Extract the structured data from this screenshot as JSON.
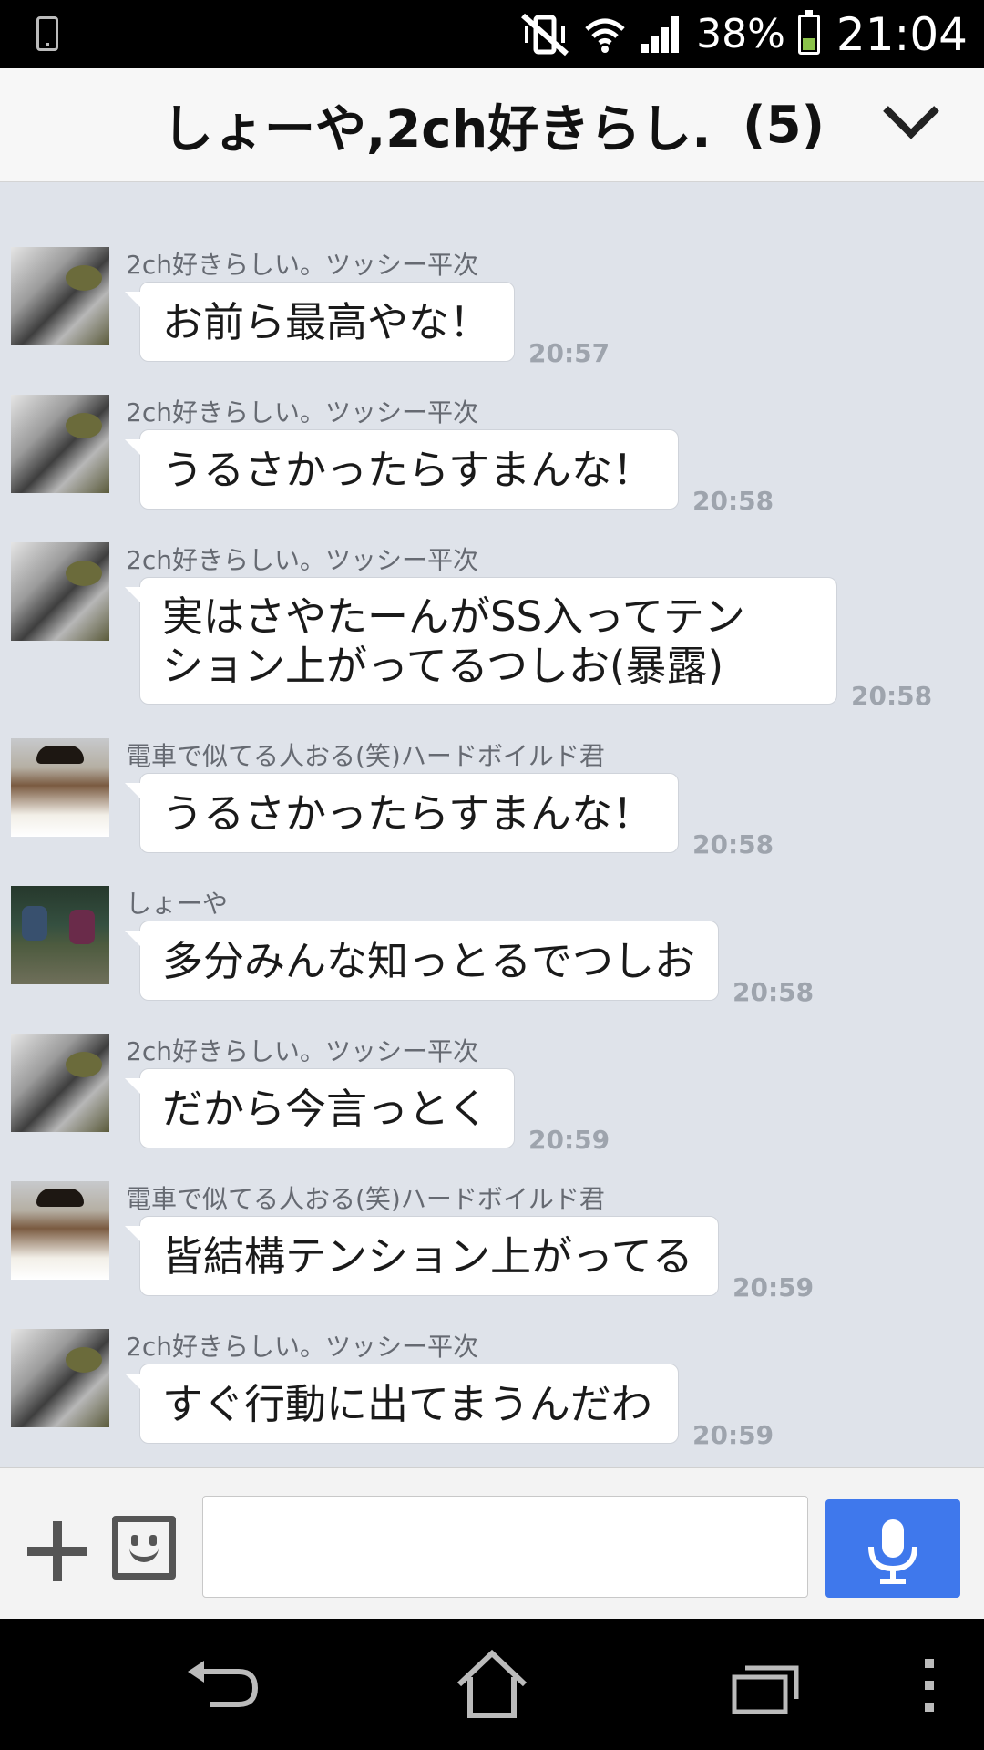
{
  "status_bar": {
    "battery_percent": "38%",
    "time": "21:04",
    "battery_level": 0.38,
    "battery_color": "#8bc34a",
    "icons": [
      "phone-icon",
      "vibrate-icon",
      "wifi-icon",
      "signal-icon",
      "battery-icon"
    ]
  },
  "header": {
    "title": "しょーや,2ch好きらし...",
    "member_count": "(5)",
    "toggle_icon": "chevron-down-icon"
  },
  "messages": [
    {
      "sender": "",
      "text": "お前ら最高やな！",
      "time": "20:57",
      "avatar": "dog"
    },
    {
      "sender": "2ch好きらしい。ツッシー平次",
      "text": "お前ら最高やな！",
      "time": "20:57",
      "avatar": "dog"
    },
    {
      "sender": "2ch好きらしい。ツッシー平次",
      "text": "うるさかったらすまんな！",
      "time": "20:58",
      "avatar": "dog"
    },
    {
      "sender": "2ch好きらしい。ツッシー平次",
      "text": "実はさやたーんがSS入ってテン\nション上がってるつしお(暴露)",
      "time": "20:58",
      "avatar": "dog"
    },
    {
      "sender": "電車で似てる人おる(笑)ハードボイルド君",
      "text": "うるさかったらすまんな！",
      "time": "20:58",
      "avatar": "boy"
    },
    {
      "sender": "しょーや",
      "text": "多分みんな知っとるでつしお",
      "time": "20:58",
      "avatar": "group"
    },
    {
      "sender": "2ch好きらしい。ツッシー平次",
      "text": "だから今言っとく",
      "time": "20:59",
      "avatar": "dog"
    },
    {
      "sender": "電車で似てる人おる(笑)ハードボイルド君",
      "text": "皆結構テンション上がってる",
      "time": "20:59",
      "avatar": "boy"
    },
    {
      "sender": "2ch好きらしい。ツッシー平次",
      "text": "すぐ行動に出てまうんだわ",
      "time": "20:59",
      "avatar": "dog"
    }
  ],
  "input_bar": {
    "message_value": "",
    "add_icon": "plus-icon",
    "sticker_icon": "emoji-icon",
    "voice_icon": "microphone-icon",
    "accent_color": "#3f78ec"
  },
  "nav_bar": {
    "icons": [
      "back-icon",
      "home-icon",
      "recent-apps-icon",
      "overflow-menu-icon"
    ]
  }
}
